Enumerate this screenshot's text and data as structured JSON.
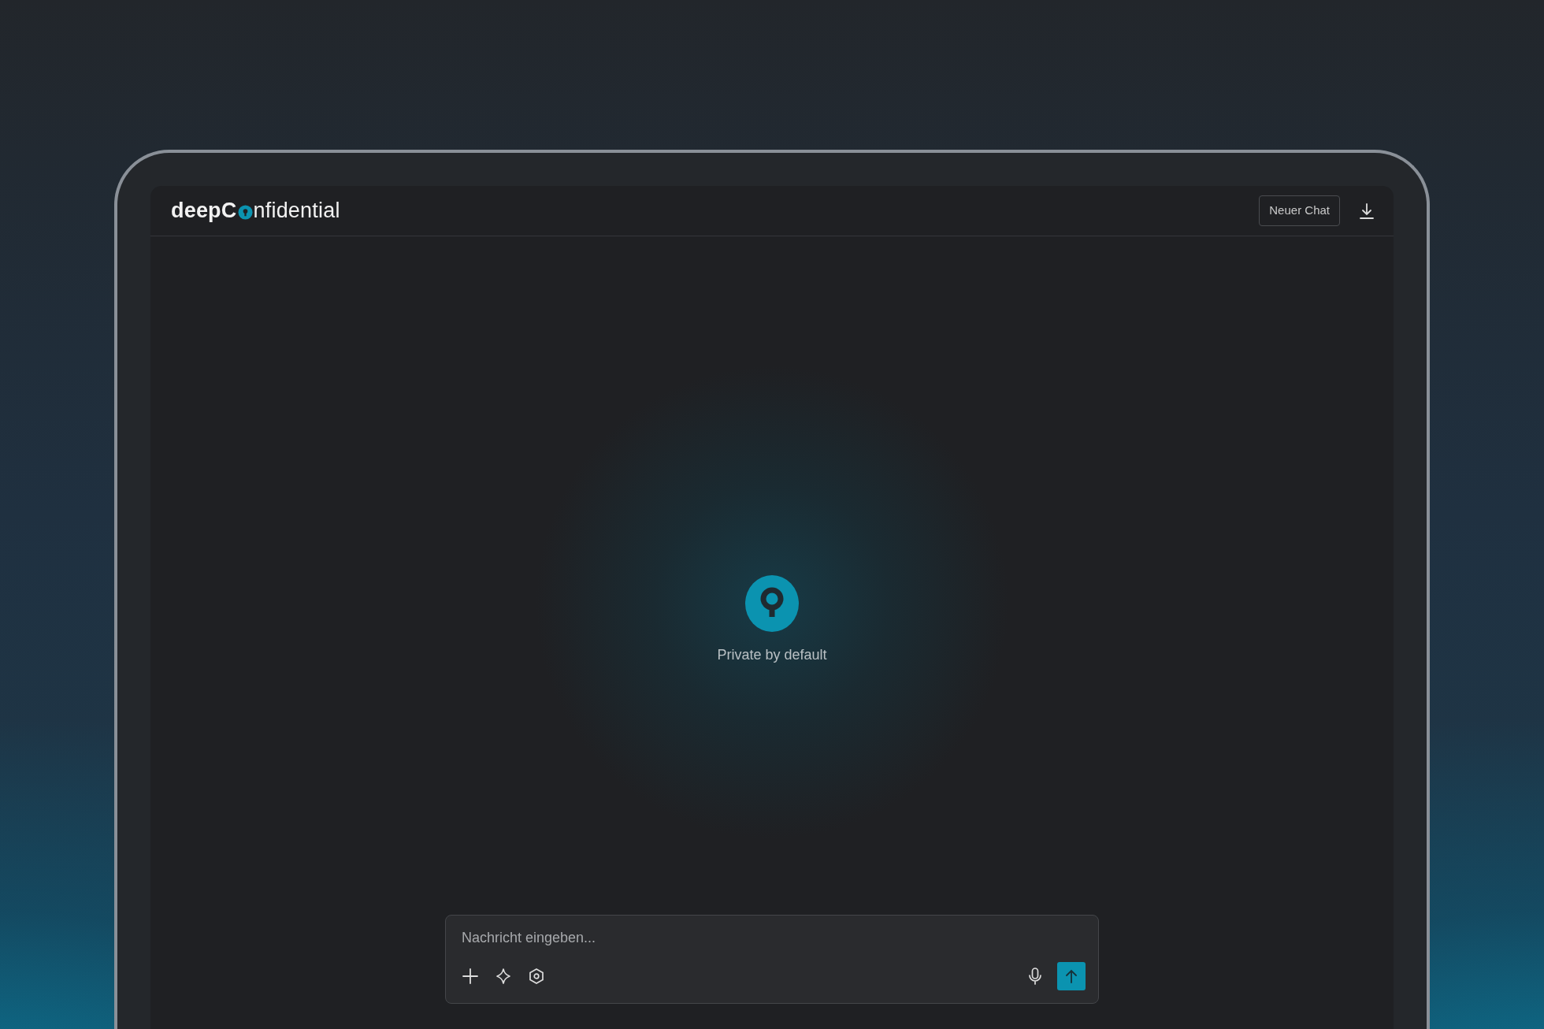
{
  "header": {
    "logo_start": "deepC",
    "logo_end": "nfidential",
    "new_chat_button": "Neuer Chat"
  },
  "empty_state": {
    "caption": "Private by default"
  },
  "composer": {
    "placeholder": "Nachricht eingeben..."
  }
}
